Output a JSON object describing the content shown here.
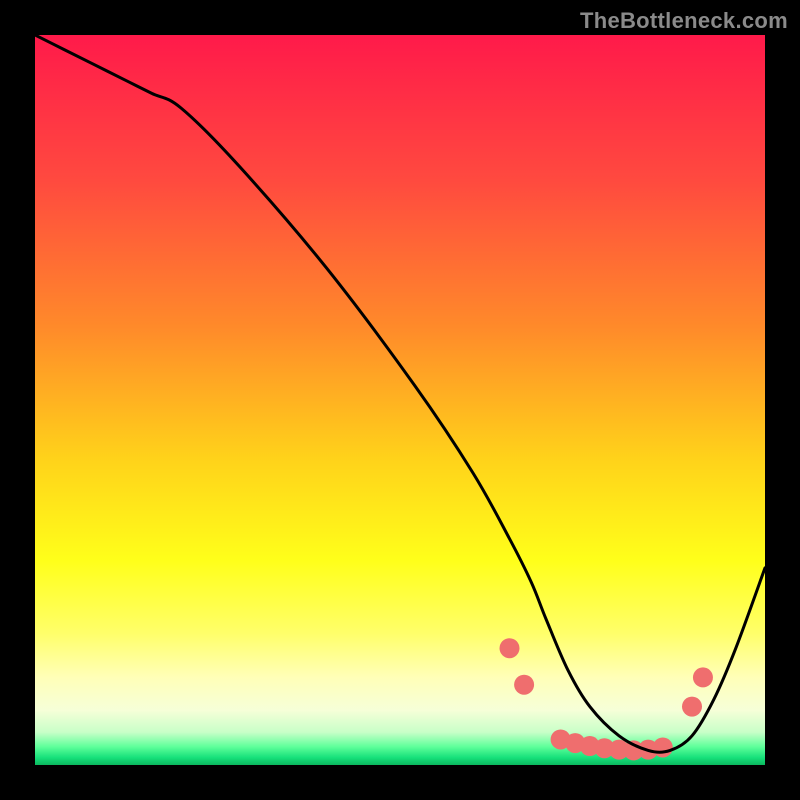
{
  "attribution": "TheBottleneck.com",
  "chart_data": {
    "type": "line",
    "title": "",
    "xlabel": "",
    "ylabel": "",
    "x_range": [
      0,
      100
    ],
    "y_range": [
      0,
      100
    ],
    "gradient_stops": [
      {
        "offset": 0.0,
        "color": "#ff1a4a"
      },
      {
        "offset": 0.2,
        "color": "#ff4a3f"
      },
      {
        "offset": 0.4,
        "color": "#ff8a2a"
      },
      {
        "offset": 0.58,
        "color": "#ffd21a"
      },
      {
        "offset": 0.72,
        "color": "#ffff1a"
      },
      {
        "offset": 0.82,
        "color": "#ffff6a"
      },
      {
        "offset": 0.88,
        "color": "#ffffb8"
      },
      {
        "offset": 0.925,
        "color": "#f6ffd8"
      },
      {
        "offset": 0.955,
        "color": "#c8ffc8"
      },
      {
        "offset": 0.975,
        "color": "#5eff9a"
      },
      {
        "offset": 0.99,
        "color": "#16e07a"
      },
      {
        "offset": 1.0,
        "color": "#0bb85e"
      }
    ],
    "series": [
      {
        "name": "curve",
        "x": [
          0,
          4,
          8,
          12,
          16,
          20,
          28,
          40,
          52,
          60,
          65,
          68,
          70,
          73,
          76,
          80,
          84,
          87,
          90,
          93,
          96,
          100
        ],
        "y": [
          100,
          98,
          96,
          94,
          92,
          90,
          82,
          68,
          52,
          40,
          31,
          25,
          20,
          13,
          8,
          4,
          2,
          2,
          4,
          9,
          16,
          27
        ]
      }
    ],
    "markers": {
      "name": "dots",
      "color": "#ef6e6e",
      "radius": 10,
      "points": [
        {
          "x": 65,
          "y": 16
        },
        {
          "x": 67,
          "y": 11
        },
        {
          "x": 72,
          "y": 3.5
        },
        {
          "x": 74,
          "y": 3
        },
        {
          "x": 76,
          "y": 2.6
        },
        {
          "x": 78,
          "y": 2.3
        },
        {
          "x": 80,
          "y": 2.1
        },
        {
          "x": 82,
          "y": 2
        },
        {
          "x": 84,
          "y": 2.1
        },
        {
          "x": 86,
          "y": 2.4
        },
        {
          "x": 90,
          "y": 8
        },
        {
          "x": 91.5,
          "y": 12
        }
      ]
    }
  }
}
